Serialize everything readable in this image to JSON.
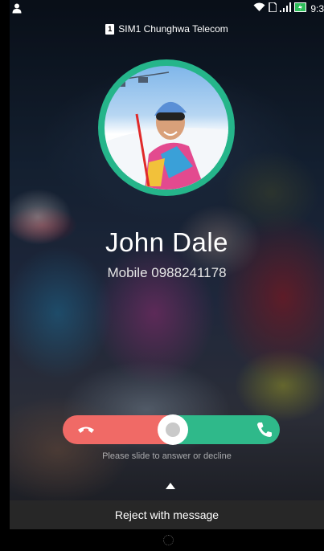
{
  "status_bar": {
    "time": "9:3",
    "left_icon": "person-icon",
    "right_icons": [
      "wifi-icon",
      "sim-card-icon",
      "signal-icon",
      "battery-icon"
    ]
  },
  "carrier": {
    "badge": "1",
    "label": "SIM1 Chunghwa Telecom"
  },
  "caller": {
    "name": "John Dale",
    "number": "Mobile 0988241178"
  },
  "slider": {
    "hint": "Please slide to answer or decline",
    "decline_color": "#f06a66",
    "answer_color": "#2fb98a",
    "decline_icon": "hang-up-icon",
    "answer_icon": "phone-icon"
  },
  "reject": {
    "label": "Reject with message"
  },
  "colors": {
    "avatar_ring": "#25b58a"
  }
}
